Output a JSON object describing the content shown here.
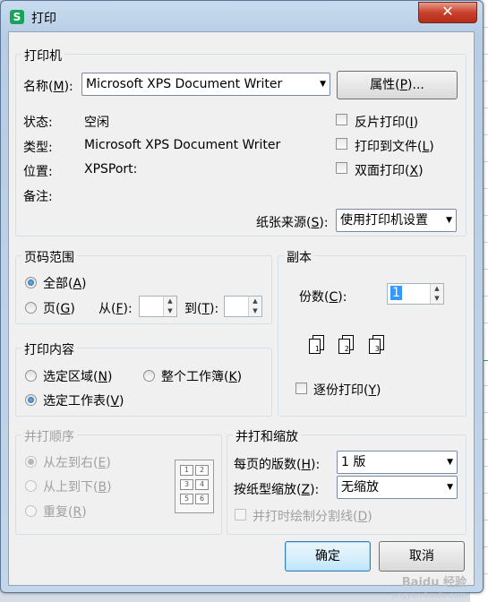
{
  "window": {
    "title": "打印",
    "app_icon_letter": "S",
    "close_symbol": "✕"
  },
  "printer": {
    "group_label": "打印机",
    "name_label": "名称(",
    "name_key": "M",
    "name_suffix": "):",
    "name_value": "Microsoft XPS Document Writer",
    "properties_label": "属性(",
    "properties_key": "P",
    "properties_suffix": ")...",
    "status_label": "状态:",
    "status_value": "空闲",
    "type_label": "类型:",
    "type_value": "Microsoft XPS Document Writer",
    "where_label": "位置:",
    "where_value": "XPSPort:",
    "comment_label": "备注:",
    "reverse_print_label": "反片打印(",
    "reverse_print_key": "I",
    "print_to_file_label": "打印到文件(",
    "print_to_file_key": "L",
    "duplex_label": "双面打印(",
    "duplex_key": "X",
    "paper_source_label": "纸张来源(",
    "paper_source_key": "S",
    "paper_source_suffix": "):",
    "paper_source_value": "使用打印机设置"
  },
  "page_range": {
    "group_label": "页码范围",
    "all_label": "全部(",
    "all_key": "A",
    "pages_label": "页(",
    "pages_key": "G",
    "from_label": "从(",
    "from_key": "F",
    "from_suffix": "):",
    "to_label": "到(",
    "to_key": "T",
    "to_suffix": "):",
    "selected": "all"
  },
  "copies": {
    "group_label": "副本",
    "count_label": "份数(",
    "count_key": "C",
    "count_suffix": "):",
    "count_value": "1",
    "collate_label": "逐份打印(",
    "collate_key": "Y",
    "collate_pages": [
      "1",
      "2",
      "3"
    ]
  },
  "print_what": {
    "group_label": "打印内容",
    "selection_label": "选定区域(",
    "selection_key": "N",
    "workbook_label": "整个工作簿(",
    "workbook_key": "K",
    "sheets_label": "选定工作表(",
    "sheets_key": "V",
    "selected": "sheets"
  },
  "order": {
    "group_label": "并打顺序",
    "ltr_label": "从左到右(",
    "ltr_key": "E",
    "ttb_label": "从上到下(",
    "ttb_key": "B",
    "repeat_label": "重复(",
    "repeat_key": "R",
    "preview_cells": [
      "1",
      "2",
      "3",
      "4",
      "5",
      "6"
    ]
  },
  "zoom": {
    "group_label": "并打和缩放",
    "pages_per_sheet_label": "每页的版数(",
    "pages_per_sheet_key": "H",
    "pages_per_sheet_suffix": "):",
    "pages_per_sheet_value": "1 版",
    "scale_label": "按纸型缩放(",
    "scale_key": "Z",
    "scale_suffix": "):",
    "scale_value": "无缩放",
    "draw_lines_label": "并打时绘制分割线(",
    "draw_lines_key": "D"
  },
  "buttons": {
    "ok": "确定",
    "cancel": "取消"
  },
  "watermark": {
    "brand": "Baidu 经验",
    "url": "jingyan.baidu.com"
  }
}
